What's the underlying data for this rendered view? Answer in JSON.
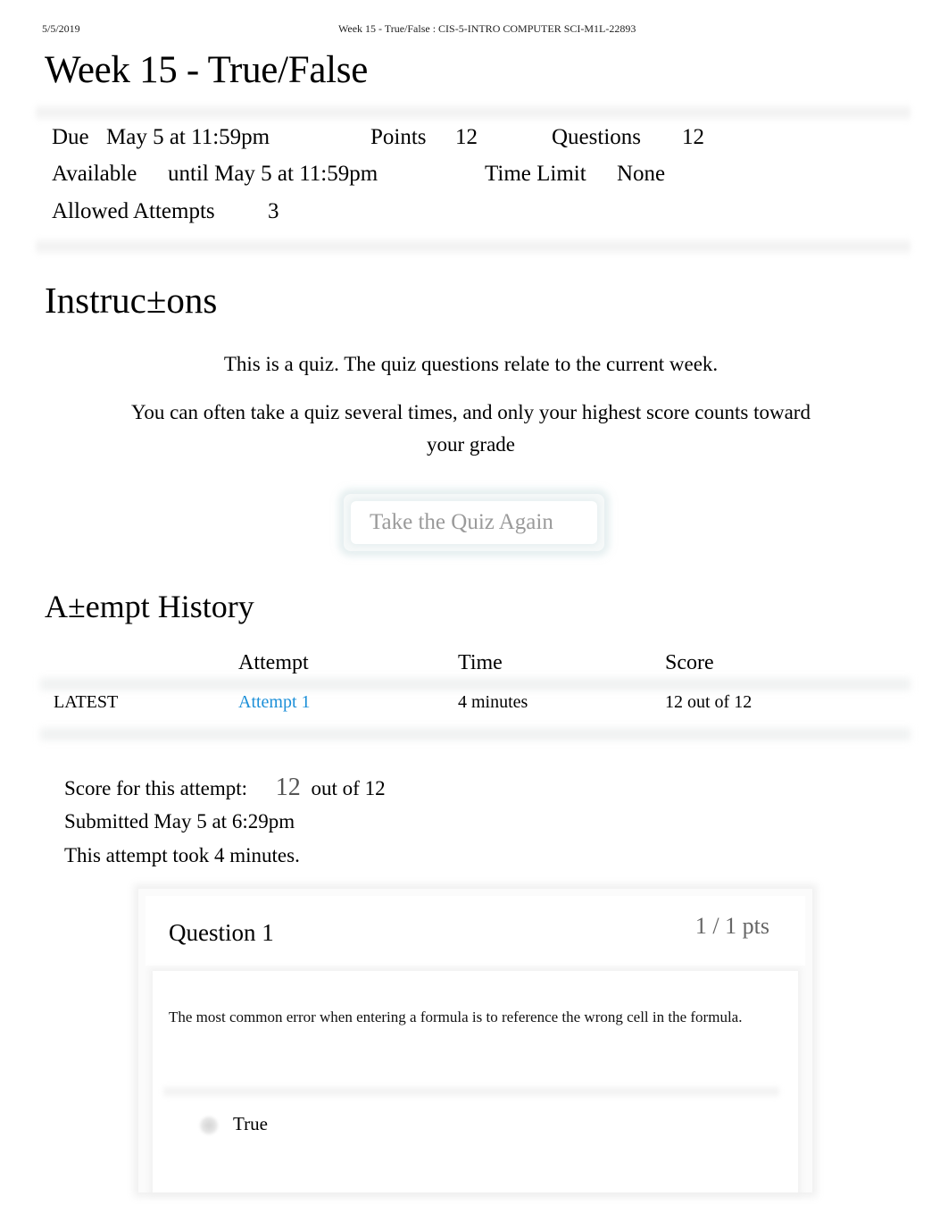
{
  "print_header": {
    "date": "5/5/2019",
    "title": "Week 15 - True/False : CIS-5-INTRO COMPUTER SCI-M1L-22893"
  },
  "page_title": "Week 15 - True/False",
  "details": {
    "due_label": "Due",
    "due_value": "May 5 at 11:59pm",
    "points_label": "Points",
    "points_value": "12",
    "questions_label": "Questions",
    "questions_value": "12",
    "available_label": "Available",
    "available_value": "until May 5 at 11:59pm",
    "time_limit_label": "Time Limit",
    "time_limit_value": "None",
    "allowed_attempts_label": "Allowed Attempts",
    "allowed_attempts_value": "3"
  },
  "instructions": {
    "heading": "Instruc±ons",
    "paragraph_1": "This is a quiz. The quiz questions relate to the current week.",
    "paragraph_2_line_1": "You can often take a quiz several times, and only your highest score counts toward",
    "paragraph_2_line_2": "your grade"
  },
  "take_quiz_button": "Take the Quiz Again",
  "attempt_history": {
    "heading": "A±empt History",
    "columns": [
      "",
      "Attempt",
      "Time",
      "Score"
    ],
    "rows": [
      {
        "tag": "LATEST",
        "attempt": "Attempt 1",
        "time": "4 minutes",
        "score": "12 out of 12"
      }
    ]
  },
  "attempt_summary": {
    "score_label": "Score for this attempt:",
    "score_value": "12",
    "score_out_of": "out of 12",
    "submitted": "Submitted May 5 at 6:29pm",
    "duration": "This attempt took 4 minutes."
  },
  "questions": [
    {
      "title": "Question 1",
      "points": "1 / 1 pts",
      "text": "The most common error when entering a formula is to reference the wrong cell in the formula.",
      "answers": [
        {
          "label": "True"
        }
      ]
    }
  ]
}
